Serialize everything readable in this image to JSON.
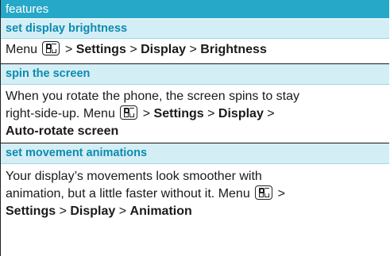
{
  "header": "features",
  "sections": [
    {
      "title": "set display brightness",
      "body": {
        "menu": "Menu",
        "path": [
          "Settings",
          "Display",
          "Brightness"
        ]
      }
    },
    {
      "title": "spin the screen",
      "body": {
        "line1": "When you rotate the phone, the screen spins to stay",
        "line2_text": "right-side-up. Menu",
        "path": [
          "Settings",
          "Display",
          "Auto-rotate screen"
        ]
      }
    },
    {
      "title": "set movement animations",
      "body": {
        "line1": "Your display’s movements look smoother with",
        "line2_text": "animation, but a little faster without it. Menu",
        "path": [
          "Settings",
          "Display",
          "Animation"
        ]
      }
    }
  ],
  "sep": ">",
  "icon": "menu-key-icon"
}
